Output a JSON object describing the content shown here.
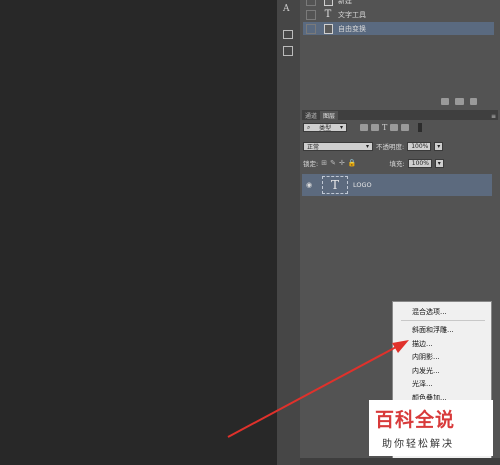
{
  "history": {
    "items": [
      {
        "label": "新建",
        "icon": "document-icon"
      },
      {
        "label": "文字工具",
        "icon": "type-tool-icon"
      },
      {
        "label": "自由变换",
        "icon": "document-icon",
        "selected": true
      }
    ]
  },
  "layers_panel": {
    "tabs": [
      "通道",
      "图层"
    ],
    "active_tab": "图层",
    "filter_kind": "类型",
    "blend_mode": "正常",
    "opacity_label": "不透明度:",
    "opacity_value": "100%",
    "lock_label": "锁定:",
    "fill_label": "填充:",
    "fill_value": "100%",
    "layers": [
      {
        "name": "LOGO",
        "thumbnail": "T"
      }
    ]
  },
  "context_menu": {
    "items": [
      "混合选项...",
      "斜面和浮雕...",
      "描边...",
      "内阴影...",
      "内发光...",
      "光泽...",
      "颜色叠加..."
    ]
  },
  "watermark": {
    "title": "百科全说",
    "subtitle": "助你轻松解决"
  },
  "colors": {
    "selection": "#5a6a80",
    "arrow": "#e0312b",
    "watermark_red": "#d83a3a"
  }
}
